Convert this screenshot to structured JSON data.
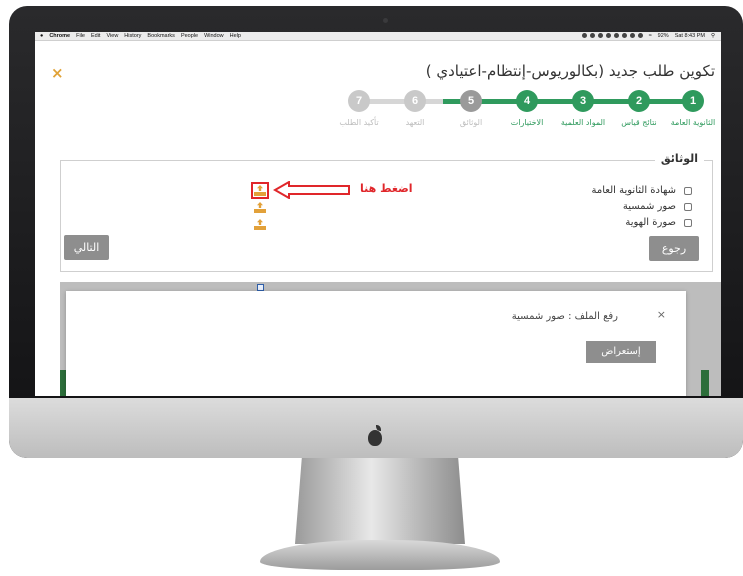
{
  "menubar": {
    "apple": "",
    "app": "Chrome",
    "menus": [
      "File",
      "Edit",
      "View",
      "History",
      "Bookmarks",
      "People",
      "Window",
      "Help"
    ],
    "battery": "92%",
    "clock": "Sat 8:43 PM"
  },
  "page": {
    "close_icon": "×",
    "title": "تكوين طلب جديد (بكالوريوس-إنتظام-اعتيادي )"
  },
  "stepper": {
    "steps": [
      {
        "num": "1",
        "label": "الثانوية العامة",
        "state": "done"
      },
      {
        "num": "2",
        "label": "نتائج قياس",
        "state": "done"
      },
      {
        "num": "3",
        "label": "المواد العلمية",
        "state": "done"
      },
      {
        "num": "4",
        "label": "الاختيارات",
        "state": "current"
      },
      {
        "num": "5",
        "label": "الوثائق",
        "state": "todo"
      },
      {
        "num": "6",
        "label": "التعهد",
        "state": "todo"
      },
      {
        "num": "7",
        "label": "تأكيد الطلب",
        "state": "todo"
      }
    ]
  },
  "documents": {
    "legend": "الوثائق",
    "items": [
      {
        "label": "شهادة الثانوية العامة"
      },
      {
        "label": "صور شمسية"
      },
      {
        "label": "صورة الهوية"
      }
    ],
    "annotation": "اضغط هنا",
    "back_label": "رجوع",
    "next_label": "التالي"
  },
  "modal": {
    "title": "رفع الملف : صور شمسية",
    "close": "×",
    "browse_label": "إستعراض"
  },
  "colors": {
    "accent_green": "#2f9a5d",
    "upload_orange": "#e2a13a",
    "annotation_red": "#e0262a",
    "button_gray": "#8e8e8e"
  }
}
